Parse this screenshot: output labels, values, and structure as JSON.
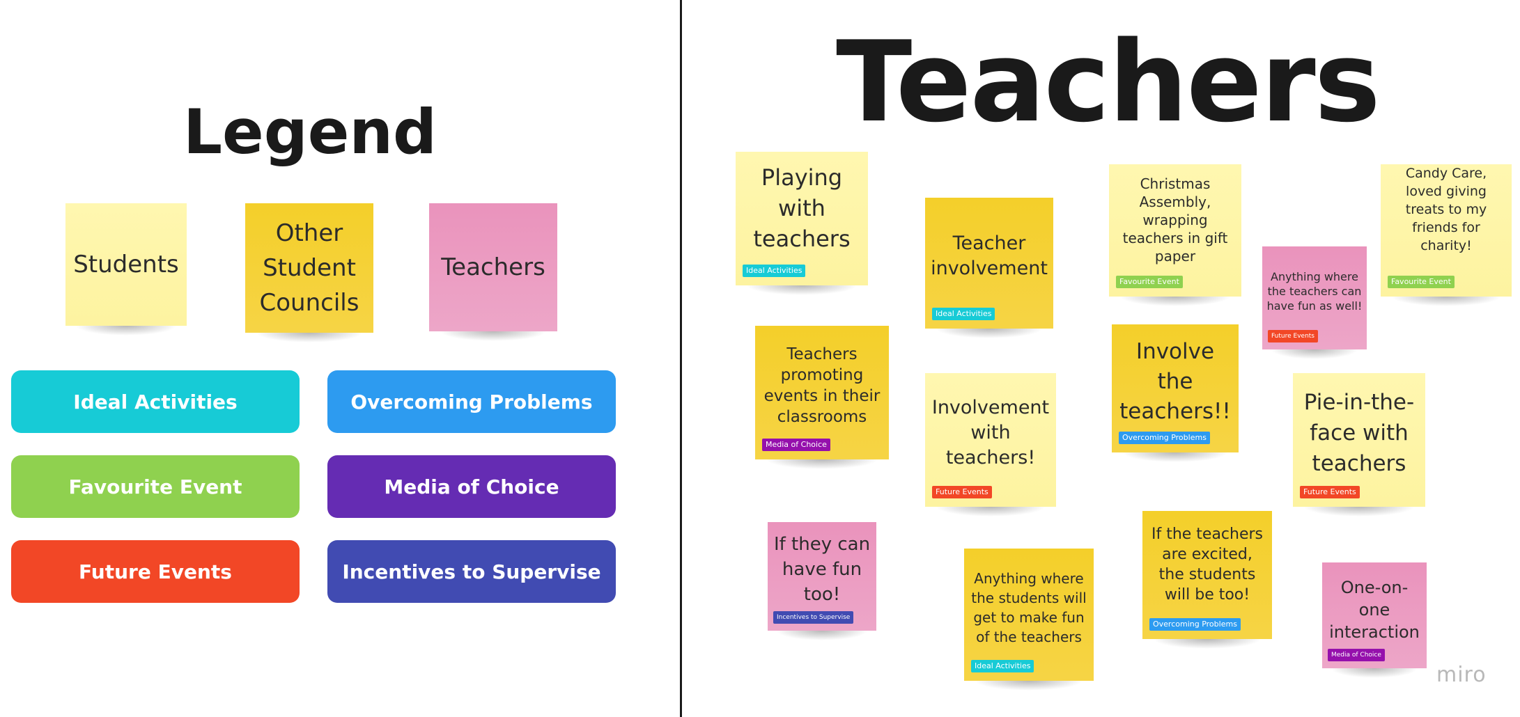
{
  "legend": {
    "title": "Legend",
    "notes": [
      {
        "label": "Students",
        "color": "#fdf3a0"
      },
      {
        "label": "Other Student Councils",
        "color": "#f4cf2a"
      },
      {
        "label": "Teachers",
        "color": "#ea93bc"
      }
    ],
    "categories": [
      {
        "label": "Ideal Activities",
        "color": "#17cbd6"
      },
      {
        "label": "Overcoming Problems",
        "color": "#2d9bf0"
      },
      {
        "label": "Favourite Event",
        "color": "#8fd14f"
      },
      {
        "label": "Media of Choice",
        "color": "#652cb3"
      },
      {
        "label": "Future Events",
        "color": "#f24726"
      },
      {
        "label": "Incentives to Supervise",
        "color": "#414bb2"
      }
    ]
  },
  "board": {
    "title": "Teachers",
    "notes": [
      {
        "text": "Playing with teachers",
        "tag": "Ideal Activities",
        "tag_color": "#17cbd6"
      },
      {
        "text": "Teacher involvement",
        "tag": "Ideal Activities",
        "tag_color": "#17cbd6"
      },
      {
        "text": "Christmas Assembly, wrapping teachers in gift paper",
        "tag": "Favourite Event",
        "tag_color": "#8fd14f"
      },
      {
        "text": "Anything where the teachers can have fun as well!",
        "tag": "Future Events",
        "tag_color": "#f24726"
      },
      {
        "text": "Candy Care, loved giving treats to my friends for charity!",
        "tag": "Favourite Event",
        "tag_color": "#8fd14f"
      },
      {
        "text": "Teachers promoting events in their classrooms",
        "tag": "Media of Choice",
        "tag_color": "#9510ac"
      },
      {
        "text": "Involvement with teachers!",
        "tag": "Future Events",
        "tag_color": "#f24726"
      },
      {
        "text": "Involve the teachers!!",
        "tag": "Overcoming Problems",
        "tag_color": "#2d9bf0"
      },
      {
        "text": "Pie-in-the-face with teachers",
        "tag": "Future Events",
        "tag_color": "#f24726"
      },
      {
        "text": "If they can have fun too!",
        "tag": "Incentives to Supervise",
        "tag_color": "#414bb2"
      },
      {
        "text": "Anything where the students will get to make fun of the teachers",
        "tag": "Ideal Activities",
        "tag_color": "#17cbd6"
      },
      {
        "text": "If the teachers are excited, the students will be too!",
        "tag": "Overcoming Problems",
        "tag_color": "#2d9bf0"
      },
      {
        "text": "One-on-one interaction",
        "tag": "Media of Choice",
        "tag_color": "#9510ac"
      }
    ]
  },
  "logo": "miro"
}
